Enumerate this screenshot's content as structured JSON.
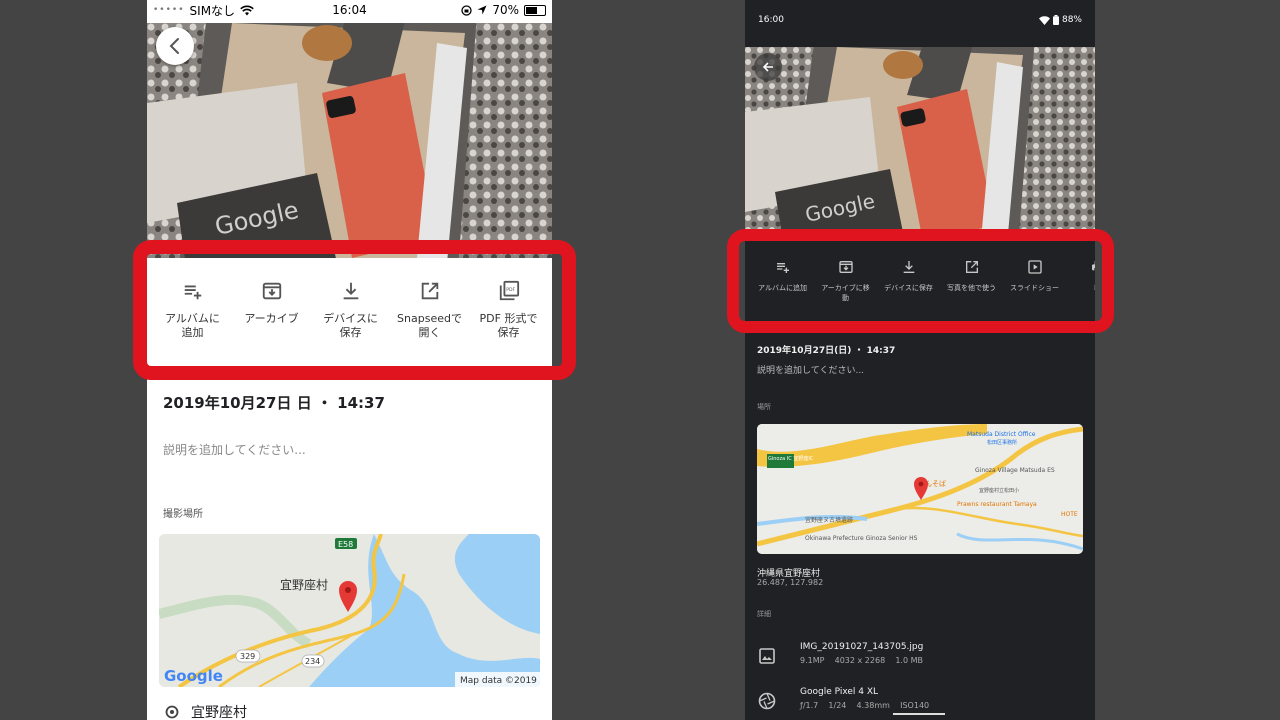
{
  "left_phone": {
    "status": {
      "carrier": "SIMなし",
      "time": "16:04",
      "battery": "70%",
      "battery_level": 0.7
    },
    "actions": [
      {
        "icon": "playlist-add-icon",
        "label": "アルバムに\n追加"
      },
      {
        "icon": "archive-icon",
        "label": "アーカイブ"
      },
      {
        "icon": "download-icon",
        "label": "デバイスに\n保存"
      },
      {
        "icon": "open-external-icon",
        "label": "Snapseedで\n開く"
      },
      {
        "icon": "pdf-icon",
        "label": "PDF 形式で\n保存"
      }
    ],
    "date": "2019年10月27日 日 ・ 14:37",
    "description_placeholder": "説明を追加してください...",
    "location_header": "撮影場所",
    "map": {
      "place_label": "宜野座村",
      "highway_label": "E58",
      "route_329": "329",
      "route_234": "234",
      "google_logo": "Google",
      "attribution": "Map data ©2019"
    },
    "place_name": "宜野座村"
  },
  "right_phone": {
    "status": {
      "time": "16:00",
      "battery": "88%",
      "battery_level": 0.88
    },
    "actions": [
      {
        "icon": "playlist-add-icon",
        "label": "アルバムに追加"
      },
      {
        "icon": "archive-icon",
        "label": "アーカイブに移\n動"
      },
      {
        "icon": "download-icon",
        "label": "デバイスに保存"
      },
      {
        "icon": "open-external-icon",
        "label": "写真を他で使う"
      },
      {
        "icon": "slideshow-icon",
        "label": "スライドショー"
      },
      {
        "icon": "print-icon",
        "label": "印"
      }
    ],
    "date": "2019年10月27日(日) ・ 14:37",
    "description_placeholder": "説明を追加してください...",
    "location_header": "場所",
    "map": {
      "label_district_office": "Matsuda District Office",
      "label_district_office_jp": "松田区事務所",
      "label_ginoza_village": "Ginoza Village\nMatsuda ES",
      "label_ginoza_jp": "宜野座村立松田小",
      "label_restaurant": "んそば",
      "label_prawns": "Prawns restaurant\nTamaya",
      "label_okinawa": "Okinawa Prefecture\nGinoza Senior HS",
      "label_hotel": "HOTE",
      "label_museum": "宜野座ヌ古墳遺跡",
      "label_ginoza_ic": "Ginoza IC\n宜野座IC"
    },
    "place_name": "沖縄県宜野座村",
    "coordinates": "26.487, 127.982",
    "details_header": "詳細",
    "file": {
      "name": "IMG_20191027_143705.jpg",
      "meta": "9.1MP    4032 x 2268    1.0 MB"
    },
    "camera": {
      "name": "Google Pixel 4 XL",
      "meta": "ƒ/1.7    1/24    4.38mm    ISO140"
    }
  },
  "colors": {
    "highlight": "#e0141e",
    "left_background": "#ffffff",
    "right_background": "#202124",
    "page_background": "#444444",
    "map_pin": "#e53935",
    "map_road": "#f4c542",
    "map_water": "#9ccff5"
  }
}
